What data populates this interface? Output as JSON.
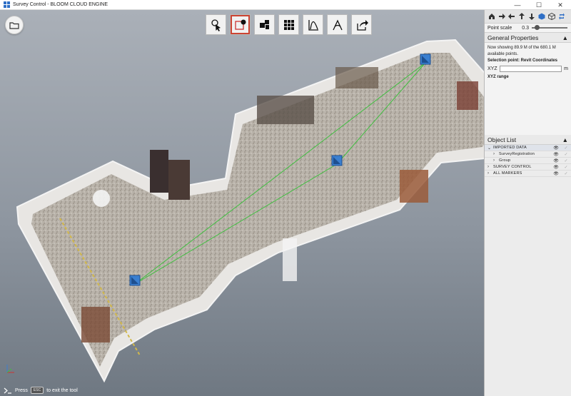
{
  "window": {
    "title": "Survey Control - BLOOM CLOUD ENGINE",
    "minimize": "—",
    "maximize": "☐",
    "close": "✕"
  },
  "toolbar": {
    "tools": [
      {
        "name": "select-tool",
        "icon": "pointer-icon",
        "active": false
      },
      {
        "name": "box-select-tool",
        "icon": "box-select-icon",
        "active": true
      },
      {
        "name": "segment-tool",
        "icon": "segment-icon",
        "active": false
      },
      {
        "name": "grid-tool",
        "icon": "grid-icon",
        "active": false
      },
      {
        "name": "profile-tool",
        "icon": "profile-icon",
        "active": false
      },
      {
        "name": "measure-tool",
        "icon": "measure-icon",
        "active": false
      },
      {
        "name": "export-tool",
        "icon": "export-icon",
        "active": false
      }
    ]
  },
  "hint": {
    "prefix": "Press",
    "key": "ESC",
    "suffix": "to exit the tool"
  },
  "panel": {
    "point_scale_label": "Point scale",
    "point_scale_value": "0.3",
    "point_scale_fraction": 0.15,
    "general_properties": {
      "title": "General Properties",
      "collapse": "▲",
      "showing_text": "Now showing 89.9 M of the 680.1 M available points.",
      "selection_label": "Selection point: Revit Coordinates",
      "xyz_label": "XYZ",
      "xyz_value": "",
      "xyz_unit": "m",
      "xyz_range": "XYZ range"
    },
    "object_list": {
      "title": "Object List",
      "collapse": "▲",
      "items": [
        {
          "label": "IMPORTED DATA",
          "chevron": "⌄"
        },
        {
          "label": "SurveyRegistration",
          "chevron": "›"
        },
        {
          "label": "Group",
          "chevron": "›"
        },
        {
          "label": "SURVEY CONTROL",
          "chevron": "›"
        },
        {
          "label": "ALL MARKERS",
          "chevron": "›"
        }
      ]
    }
  },
  "colors": {
    "accent": "#2f6fc6",
    "marker": "#3a7fd0",
    "line": "#3fbf3f"
  }
}
